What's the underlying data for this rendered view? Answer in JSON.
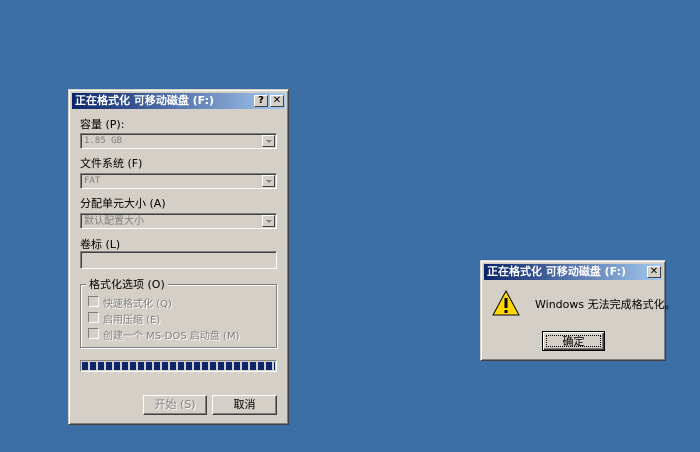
{
  "format_dialog": {
    "title": "正在格式化 可移动磁盘 (F:)",
    "help_button": "?",
    "close_button": "✕",
    "capacity_label": "容量 (P):",
    "capacity_value": "1.85 GB",
    "filesystem_label": "文件系统 (F)",
    "filesystem_value": "FAT",
    "allocation_label": "分配单元大小 (A)",
    "allocation_value": "默认配置大小",
    "volume_label": "卷标 (L)",
    "volume_value": "",
    "options_group": "格式化选项 (O)",
    "options": [
      {
        "label": "快速格式化 (Q)",
        "checked": false
      },
      {
        "label": "启用压缩 (E)",
        "checked": false
      },
      {
        "label": "创建一个 MS-DOS 启动盘 (M)",
        "checked": false
      }
    ],
    "progress": 1.0,
    "start_button": "开始 (S)",
    "cancel_button": "取消"
  },
  "message_box": {
    "title": "正在格式化 可移动磁盘 (F:)",
    "close_button": "✕",
    "icon": "warning-icon",
    "message": "Windows 无法完成格式化。",
    "ok_button": "确定"
  }
}
